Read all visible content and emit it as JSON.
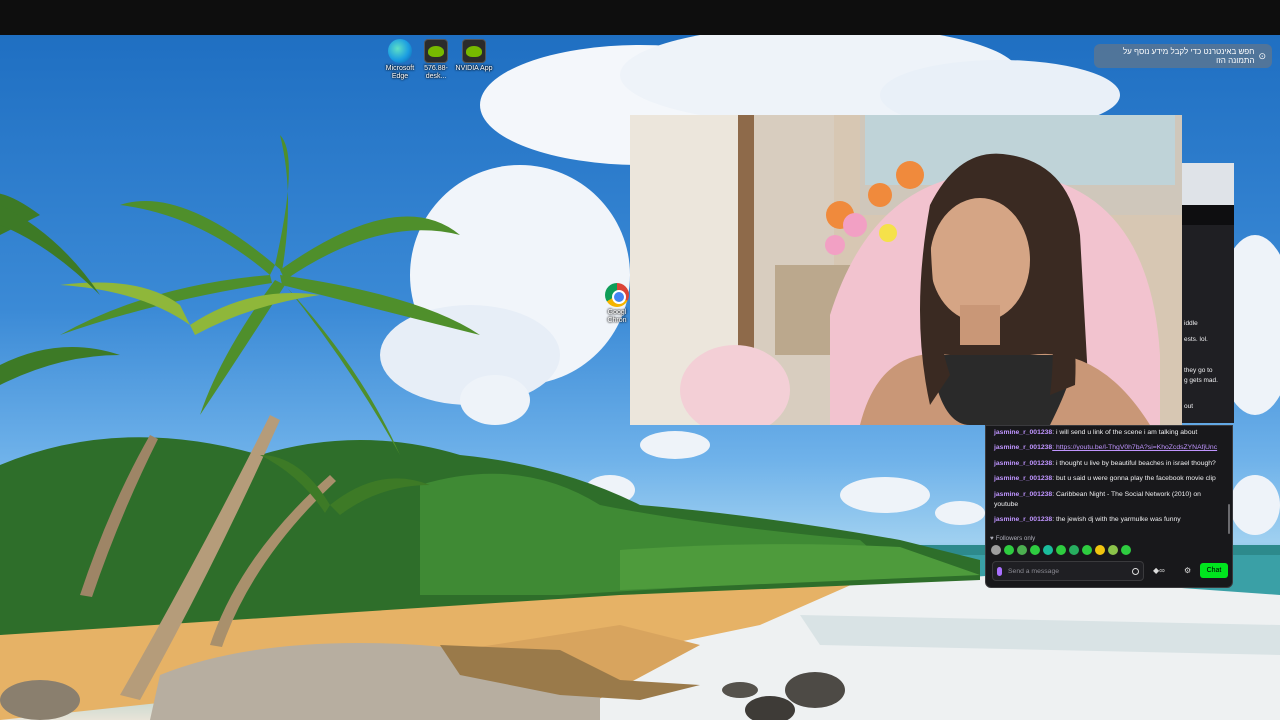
{
  "desktop_icons": [
    {
      "name": "edge",
      "label_line1": "Microsoft",
      "label_line2": "Edge"
    },
    {
      "name": "nvidia-driver",
      "label_line1": "576.88-desk...",
      "label_line2": ""
    },
    {
      "name": "nvidia-app",
      "label_line1": "NVIDIA App",
      "label_line2": ""
    },
    {
      "name": "chrome",
      "label_line1": "Googl",
      "label_line2": "Chron"
    }
  ],
  "notification": {
    "text": "חפש באינטרנט כדי לקבל מידע נוסף על התמונה הזו"
  },
  "browser_peek": [
    "iddle",
    "ests. lol.",
    "they go to",
    "g gets mad.",
    "out"
  ],
  "chat": {
    "messages": [
      {
        "user": "jasmine_r_001238",
        "text": ": i will send u link of the scene i am talking about",
        "is_link": false
      },
      {
        "user": "jasmine_r_001238",
        "text": ": https://youtu.be/l-ThgV0h7bA?si=KhoZcdsZYNAfjUnc",
        "is_link": true
      },
      {
        "user": "jasmine_r_001238",
        "text": ": i thought u live by beautiful beaches in israel though?",
        "is_link": false
      },
      {
        "user": "jasmine_r_001238",
        "text": ": but u said u were gonna play the facebook movie clip",
        "is_link": false
      },
      {
        "user": "jasmine_r_001238",
        "text": ": Caribbean Night - The Social Network (2010) on youtube",
        "is_link": false
      },
      {
        "user": "jasmine_r_001238",
        "text": ": the jewish dj with the yarmulke was funny",
        "is_link": false
      }
    ],
    "followers_only": "Followers only",
    "input_placeholder": "Send a message",
    "chat_button": "Chat",
    "emote_colors": [
      "#9e9e9e",
      "#2ecc40",
      "#4caf50",
      "#2ecc40",
      "#1abc9c",
      "#2ecc40",
      "#27ae60",
      "#2ecc40",
      "#f1c40f",
      "#8bc34a",
      "#2ecc40"
    ]
  }
}
